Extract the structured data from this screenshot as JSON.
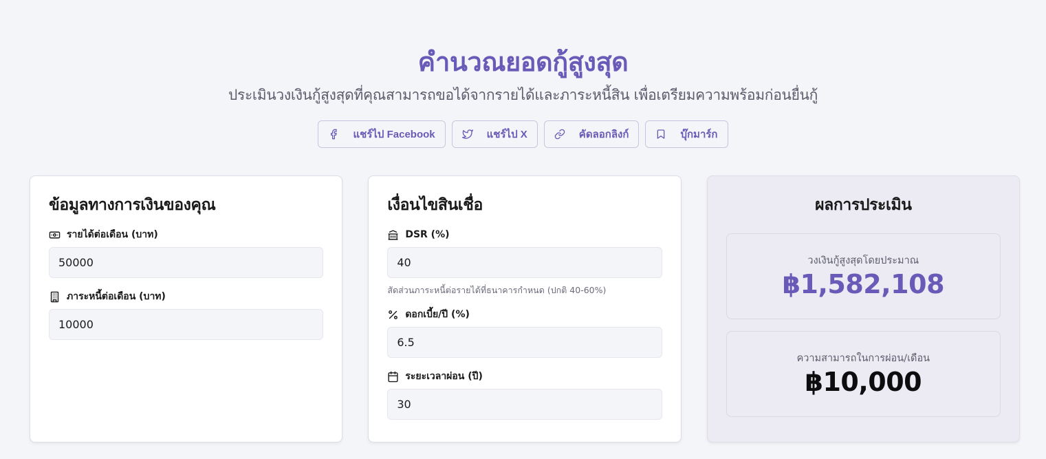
{
  "header": {
    "title": "คำนวณยอดกู้สูงสุด",
    "subtitle": "ประเมินวงเงินกู้สูงสุดที่คุณสามารถขอได้จากรายได้และภาระหนี้สิน เพื่อเตรียมความพร้อมก่อนยื่นกู้"
  },
  "share": [
    {
      "label": "แชร์ไป Facebook",
      "icon": "facebook-icon"
    },
    {
      "label": "แชร์ไป X",
      "icon": "twitter-icon"
    },
    {
      "label": "คัดลอกลิงก์",
      "icon": "link-icon"
    },
    {
      "label": "บุ๊กมาร์ก",
      "icon": "bookmark-icon"
    }
  ],
  "financial": {
    "title": "ข้อมูลทางการเงินของคุณ",
    "income_label": "รายได้ต่อเดือน (บาท)",
    "income_value": "50000",
    "debt_label": "ภาระหนี้ต่อเดือน (บาท)",
    "debt_value": "10000"
  },
  "loan": {
    "title": "เงื่อนไขสินเชื่อ",
    "dsr_label": "DSR (%)",
    "dsr_value": "40",
    "dsr_hint": "สัดส่วนภาระหนี้ต่อรายได้ที่ธนาคารกำหนด (ปกติ 40-60%)",
    "rate_label": "ดอกเบี้ย/ปี (%)",
    "rate_value": "6.5",
    "term_label": "ระยะเวลาผ่อน (ปี)",
    "term_value": "30"
  },
  "result": {
    "title": "ผลการประเมิน",
    "max_loan_label": "วงเงินกู้สูงสุดโดยประมาณ",
    "max_loan_value": "฿1,582,108",
    "capacity_label": "ความสามารถในการผ่อน/เดือน",
    "capacity_value": "฿10,000"
  },
  "colors": {
    "accent": "#6a5ab8",
    "background": "#f4f5f9",
    "result_card": "#ecebf4"
  }
}
